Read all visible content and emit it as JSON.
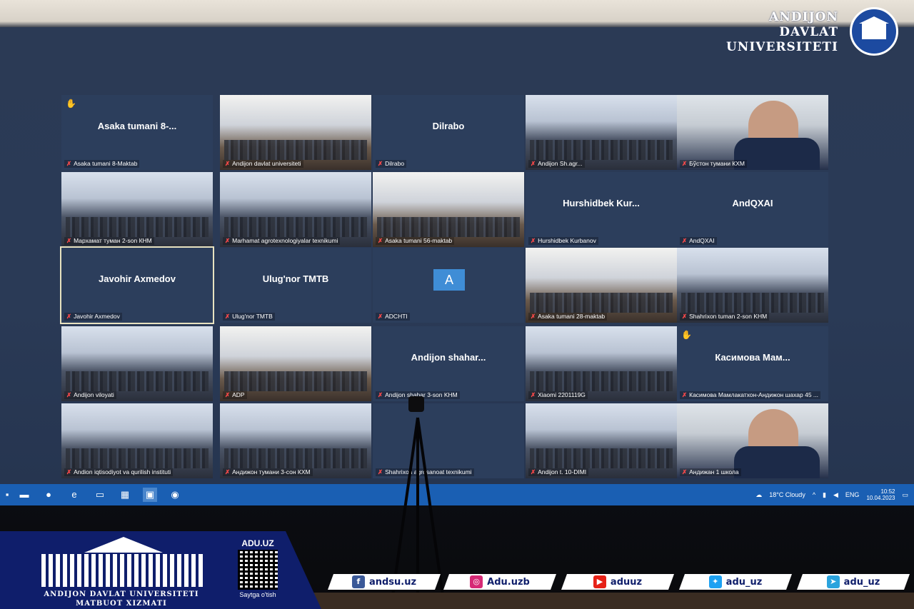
{
  "university": {
    "line1": "ANDIJON",
    "line2": "DAVLAT",
    "line3": "UNIVERSITETI"
  },
  "tiles": [
    {
      "kind": "name",
      "name": "Asaka tumani 8-...",
      "label": "Asaka tumani 8-Maktab",
      "hand": true
    },
    {
      "kind": "scene",
      "label": "Andijon davlat universiteti"
    },
    {
      "kind": "name",
      "name": "Dilrabo",
      "label": "Dilrabo"
    },
    {
      "kind": "scene",
      "label": "Andijon Sh.agr..."
    },
    {
      "kind": "face",
      "label": "Бўстон тумани КХМ"
    },
    {
      "kind": "scene",
      "label": "Мархамат туман 2-son КНМ"
    },
    {
      "kind": "scene",
      "label": "Marhamat agrotexnologiyalar texnikumi"
    },
    {
      "kind": "scene",
      "label": "Asaka tumani 56-maktab"
    },
    {
      "kind": "name",
      "name": "Hurshidbek Kur...",
      "label": "Hurshidbek Kurbanov"
    },
    {
      "kind": "name",
      "name": "AndQXAI",
      "label": "AndQXAI"
    },
    {
      "kind": "name",
      "name": "Javohir Axmedov",
      "label": "Javohir Axmedov",
      "highlight": true
    },
    {
      "kind": "name",
      "name": "Ulug'nor TMTB",
      "label": "Ulug'nor TMTB"
    },
    {
      "kind": "avatar",
      "avatar": "A",
      "label": "ADCHTI"
    },
    {
      "kind": "scene",
      "label": "Asaka tumani 28-maktab"
    },
    {
      "kind": "scene",
      "label": "Shahrixon tuman 2-son KHM"
    },
    {
      "kind": "scene",
      "label": "Andijon viloyati"
    },
    {
      "kind": "scene",
      "label": "ADP"
    },
    {
      "kind": "name",
      "name": "Andijon shahar...",
      "label": "Andijon shahar 3-son KHM"
    },
    {
      "kind": "scene",
      "label": "Xiaomi 2201119G"
    },
    {
      "kind": "name",
      "name": "Касимова Мам...",
      "label": "Касимова Мамлакатхон-Андижон шахар 45 ...",
      "hand": true
    },
    {
      "kind": "scene",
      "label": "Andion iqtisodiyot va qurilish instituti"
    },
    {
      "kind": "scene",
      "label": "Андижон тумани 3-сон КХМ"
    },
    {
      "kind": "name",
      "name": "",
      "label": "Shahrixon agrosanoat texnikumi"
    },
    {
      "kind": "scene",
      "label": "Andijon t. 10-DIMI"
    },
    {
      "kind": "face",
      "label": "Андижан 1 школа"
    }
  ],
  "taskbar": {
    "weather": "18°C Cloudy",
    "lang": "ENG",
    "time": "10:52",
    "date": "10.04.2023"
  },
  "banner": {
    "title1": "ANDIJON DAVLAT UNIVERSITETI",
    "title2": "MATBUOT XIZMATI",
    "site": "ADU.UZ",
    "qr_caption": "Saytga o'tish"
  },
  "socials": [
    {
      "icon": "facebook-icon",
      "glyph": "f",
      "color": "#3b5998",
      "text": "andsu.uz"
    },
    {
      "icon": "instagram-icon",
      "glyph": "◎",
      "color": "#d62976",
      "text": "Adu.uzb"
    },
    {
      "icon": "youtube-icon",
      "glyph": "▶",
      "color": "#e62117",
      "text": "aduuz"
    },
    {
      "icon": "twitter-icon",
      "glyph": "✦",
      "color": "#1da1f2",
      "text": "adu_uz"
    },
    {
      "icon": "telegram-icon",
      "glyph": "➤",
      "color": "#2aa3dd",
      "text": "adu_uz"
    }
  ]
}
